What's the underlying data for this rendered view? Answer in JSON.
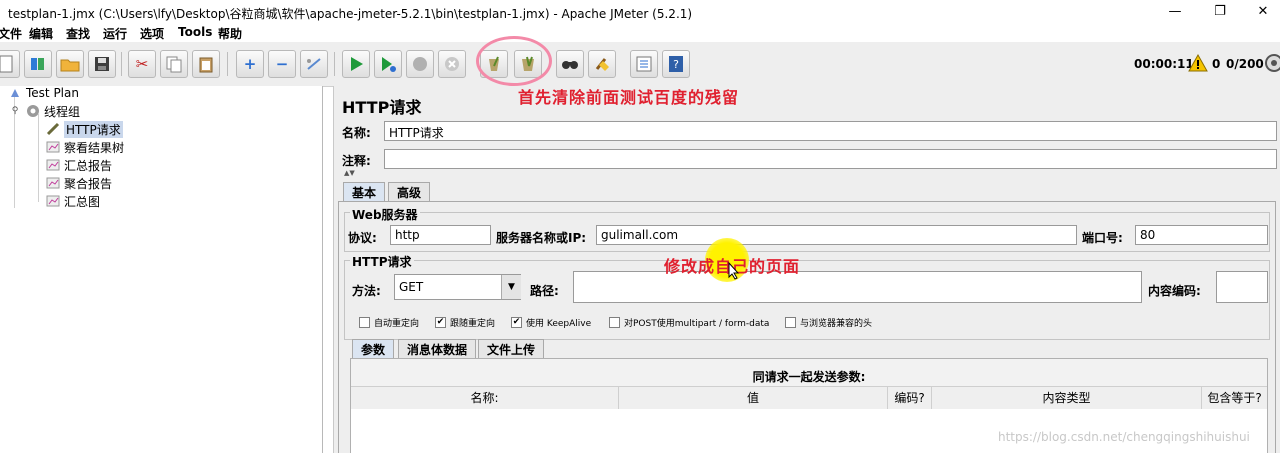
{
  "window": {
    "title": "testplan-1.jmx (C:\\Users\\lfy\\Desktop\\谷粒商城\\软件\\apache-jmeter-5.2.1\\bin\\testplan-1.jmx) - Apache JMeter (5.2.1)",
    "minimize": "—",
    "maximize": "❐",
    "close": "✕"
  },
  "menu": [
    "文件",
    "编辑",
    "查找",
    "运行",
    "选项",
    "Tools",
    "帮助"
  ],
  "toolbar": {
    "timer": "00:00:11",
    "warning_count": "0",
    "threads": "0/200"
  },
  "tree": {
    "root": "Test Plan",
    "thread_group": "线程组",
    "children": [
      "HTTP请求",
      "察看结果树",
      "汇总报告",
      "聚合报告",
      "汇总图"
    ]
  },
  "panel": {
    "title": "HTTP请求",
    "name_label": "名称:",
    "name_value": "HTTP请求",
    "comment_label": "注释:",
    "comment_value": "",
    "tabs": [
      "基本",
      "高级"
    ],
    "web_server": {
      "title": "Web服务器",
      "protocol_label": "协议:",
      "protocol_value": "http",
      "server_label": "服务器名称或IP:",
      "server_value": "gulimall.com",
      "port_label": "端口号:",
      "port_value": "80"
    },
    "http_request": {
      "title": "HTTP请求",
      "method_label": "方法:",
      "method_value": "GET",
      "path_label": "路径:",
      "path_value": "",
      "encoding_label": "内容编码:",
      "encoding_value": ""
    },
    "options": [
      {
        "label": "自动重定向",
        "checked": false
      },
      {
        "label": "跟随重定向",
        "checked": true
      },
      {
        "label": "使用 KeepAlive",
        "checked": true
      },
      {
        "label": "对POST使用multipart / form-data",
        "checked": false
      },
      {
        "label": "与浏览器兼容的头",
        "checked": false
      }
    ],
    "subtabs": [
      "参数",
      "消息体数据",
      "文件上传"
    ],
    "params_caption": "同请求一起发送参数:",
    "columns": [
      "名称:",
      "值",
      "编码?",
      "内容类型",
      "包含等于?"
    ]
  },
  "annotations": {
    "top": "首先清除前面测试百度的残留",
    "middle": "修改成自己的页面"
  },
  "watermark": "https://blog.csdn.net/chengqingshihuishui",
  "colors": {
    "annotation_red": "#e0202f",
    "run_green": "#1e9a3a",
    "highlight_yellow": "#fff200"
  }
}
